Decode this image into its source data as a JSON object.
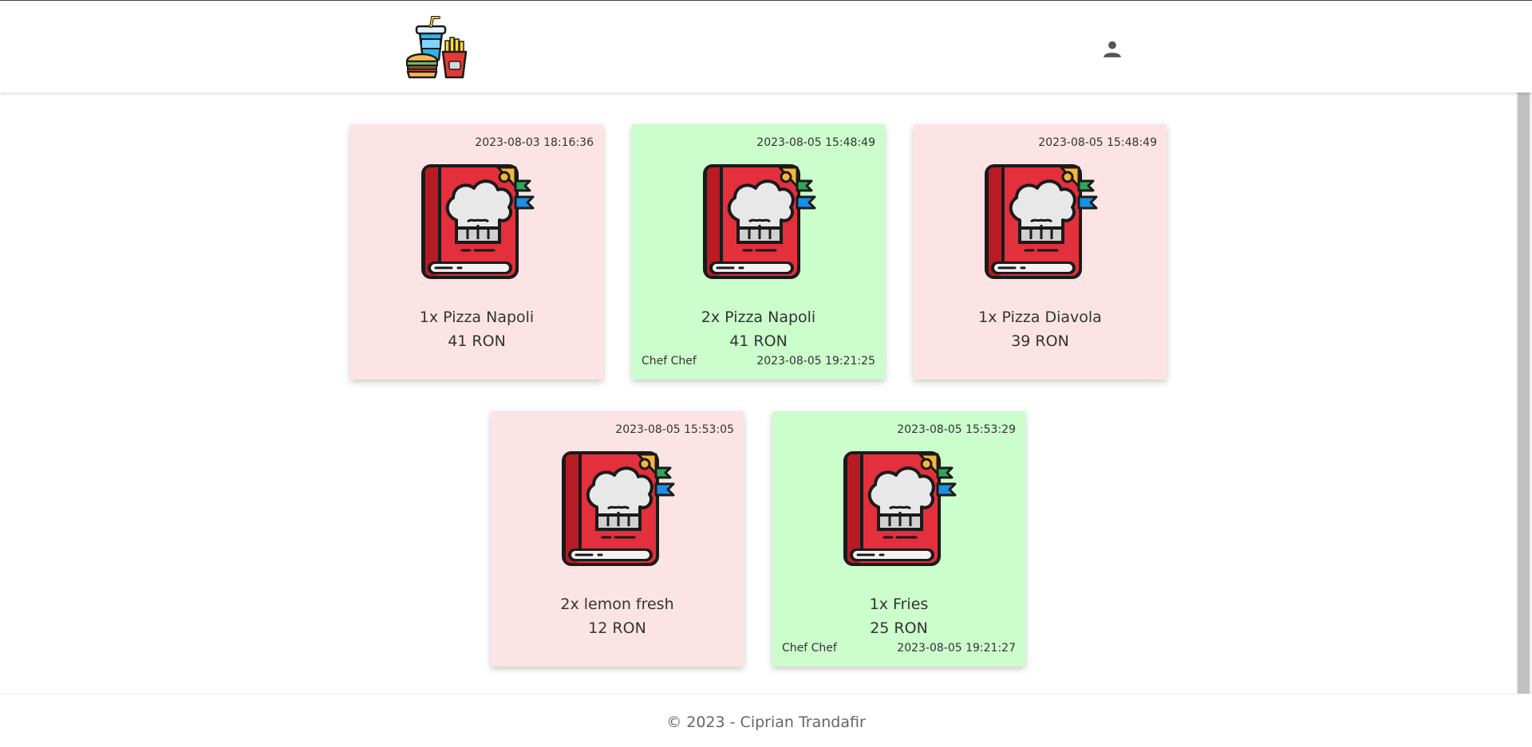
{
  "header": {
    "logo_icon": "fast-food-logo-icon",
    "user_icon": "person-icon"
  },
  "orders": [
    {
      "created": "2023-08-03 18:16:36",
      "item": "1x Pizza Napoli",
      "price": "41 RON",
      "status": "pending",
      "chef": "",
      "finished": ""
    },
    {
      "created": "2023-08-05 15:48:49",
      "item": "2x Pizza Napoli",
      "price": "41 RON",
      "status": "done",
      "chef": "Chef Chef",
      "finished": "2023-08-05 19:21:25"
    },
    {
      "created": "2023-08-05 15:48:49",
      "item": "1x Pizza Diavola",
      "price": "39 RON",
      "status": "pending",
      "chef": "",
      "finished": ""
    },
    {
      "created": "2023-08-05 15:53:05",
      "item": "2x lemon fresh",
      "price": "12 RON",
      "status": "pending",
      "chef": "",
      "finished": ""
    },
    {
      "created": "2023-08-05 15:53:29",
      "item": "1x Fries",
      "price": "25 RON",
      "status": "done",
      "chef": "Chef Chef",
      "finished": "2023-08-05 19:21:27"
    }
  ],
  "colors": {
    "pending": "#fde4e4",
    "done": "#ccfdcc",
    "book_red": "#e3303c",
    "book_dark": "#b71c25"
  },
  "footer": {
    "copyright": "© 2023 - Ciprian Trandafir"
  }
}
